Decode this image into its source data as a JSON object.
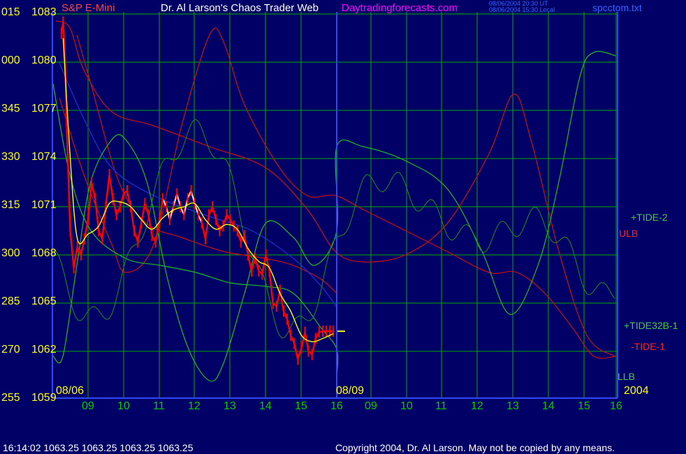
{
  "header": {
    "symbol": "S&P E-Mini",
    "title": "Dr. Al Larson's Chaos Trader Web",
    "site": "Daytradingforecasts.com",
    "time_utc": "08/06/2004 20:30 UT",
    "time_local": "08/06/2004 15:30 Local",
    "filename": "spcctom.txt"
  },
  "footer": {
    "quote": "16:14:02  1063.25  1063.25  1063.25  1063.25",
    "copyright": "Copyright 2004, Dr. Al Larson. May not be copied by any means."
  },
  "colors": {
    "background": "#000066",
    "grid": "#00aa00",
    "price_red": "#ff0000",
    "price_white": "#ffffff",
    "average_yellow": "#ffff00",
    "tide_green": "#22bb22",
    "band_red": "#cc1111",
    "band_blue": "#2233cc",
    "border_blue": "#3344ff"
  },
  "chart_data": {
    "type": "line",
    "title": "S&P E-Mini",
    "y_left_labels": [
      "015",
      "000",
      "345",
      "330",
      "315",
      "300",
      "285",
      "270",
      "255"
    ],
    "y_price_labels": [
      "1083",
      "1080",
      "1077",
      "1074",
      "1071",
      "1068",
      "1065",
      "1062",
      "1059"
    ],
    "ylim": [
      1059,
      1083
    ],
    "x_labels": [
      "09",
      "10",
      "11",
      "12",
      "13",
      "14",
      "15",
      "16",
      "09",
      "10",
      "11",
      "12",
      "13",
      "14",
      "15",
      "16"
    ],
    "date_labels": [
      "08/06",
      "08/09"
    ],
    "year_label": "2004",
    "grid": true,
    "legend": [
      {
        "name": "+TIDE-2",
        "color": "#44cc44"
      },
      {
        "name": "ULB",
        "color": "#ff2222"
      },
      {
        "name": "+TIDE32B-1",
        "color": "#44cc44"
      },
      {
        "name": "-TIDE-1",
        "color": "#ff2222"
      },
      {
        "name": "LLB",
        "color": "#44cc44"
      }
    ],
    "last_price": 1063.25,
    "price_series": {
      "x": [
        8.25,
        8.3,
        8.35,
        8.4,
        8.5,
        8.6,
        8.7,
        8.8,
        8.9,
        9.0,
        9.1,
        9.2,
        9.3,
        9.4,
        9.5,
        9.6,
        9.7,
        9.8,
        9.9,
        10.0,
        10.1,
        10.2,
        10.3,
        10.4,
        10.5,
        10.6,
        10.7,
        10.8,
        10.9,
        11.0,
        11.1,
        11.2,
        11.3,
        11.4,
        11.5,
        11.6,
        11.7,
        11.8,
        11.9,
        12.0,
        12.1,
        12.2,
        12.3,
        12.4,
        12.5,
        12.6,
        12.7,
        12.8,
        12.9,
        13.0,
        13.1,
        13.2,
        13.3,
        13.4,
        13.5,
        13.6,
        13.7,
        13.8,
        13.9,
        14.0,
        14.1,
        14.2,
        14.3,
        14.4,
        14.5,
        14.6,
        14.7,
        14.8,
        14.9,
        15.0,
        15.1,
        15.2,
        15.3,
        15.4,
        15.5,
        15.6,
        15.7,
        15.8,
        15.9,
        16.0
      ],
      "y": [
        1081.8,
        1082.5,
        1080.5,
        1076.0,
        1069.5,
        1067.2,
        1068.5,
        1068.0,
        1069.0,
        1070.2,
        1072.5,
        1071.5,
        1069.5,
        1069.0,
        1071.0,
        1073.0,
        1071.5,
        1070.5,
        1071.0,
        1071.8,
        1072.0,
        1071.0,
        1069.5,
        1068.8,
        1070.0,
        1071.2,
        1070.5,
        1069.2,
        1068.8,
        1070.0,
        1071.5,
        1071.0,
        1070.2,
        1071.0,
        1071.8,
        1071.0,
        1070.5,
        1071.5,
        1072.0,
        1071.2,
        1070.5,
        1070.0,
        1069.0,
        1070.5,
        1071.0,
        1070.2,
        1069.5,
        1069.8,
        1070.5,
        1070.2,
        1069.8,
        1069.5,
        1068.8,
        1069.2,
        1068.0,
        1067.0,
        1067.8,
        1067.0,
        1066.8,
        1068.0,
        1067.0,
        1065.0,
        1064.8,
        1065.8,
        1064.5,
        1064.0,
        1063.0,
        1062.5,
        1061.5,
        1062.2,
        1063.2,
        1062.0,
        1061.8,
        1062.8,
        1063.2,
        1063.25,
        1063.25,
        1063.25,
        1063.25,
        1063.25
      ]
    },
    "average_series": {
      "x": [
        8.3,
        8.5,
        8.7,
        9.0,
        9.3,
        9.6,
        9.9,
        10.2,
        10.5,
        10.8,
        11.1,
        11.4,
        11.7,
        12.0,
        12.3,
        12.6,
        12.9,
        13.2,
        13.5,
        13.8,
        14.1,
        14.4,
        14.7,
        15.0,
        15.3,
        15.6,
        15.9
      ],
      "y": [
        1081.5,
        1074.0,
        1069.0,
        1069.3,
        1069.8,
        1071.2,
        1071.3,
        1071.0,
        1070.2,
        1069.6,
        1070.3,
        1070.8,
        1071.0,
        1071.2,
        1070.2,
        1069.6,
        1069.9,
        1069.6,
        1068.4,
        1067.6,
        1067.2,
        1065.6,
        1064.5,
        1063.0,
        1062.6,
        1062.8,
        1063.1
      ]
    }
  }
}
